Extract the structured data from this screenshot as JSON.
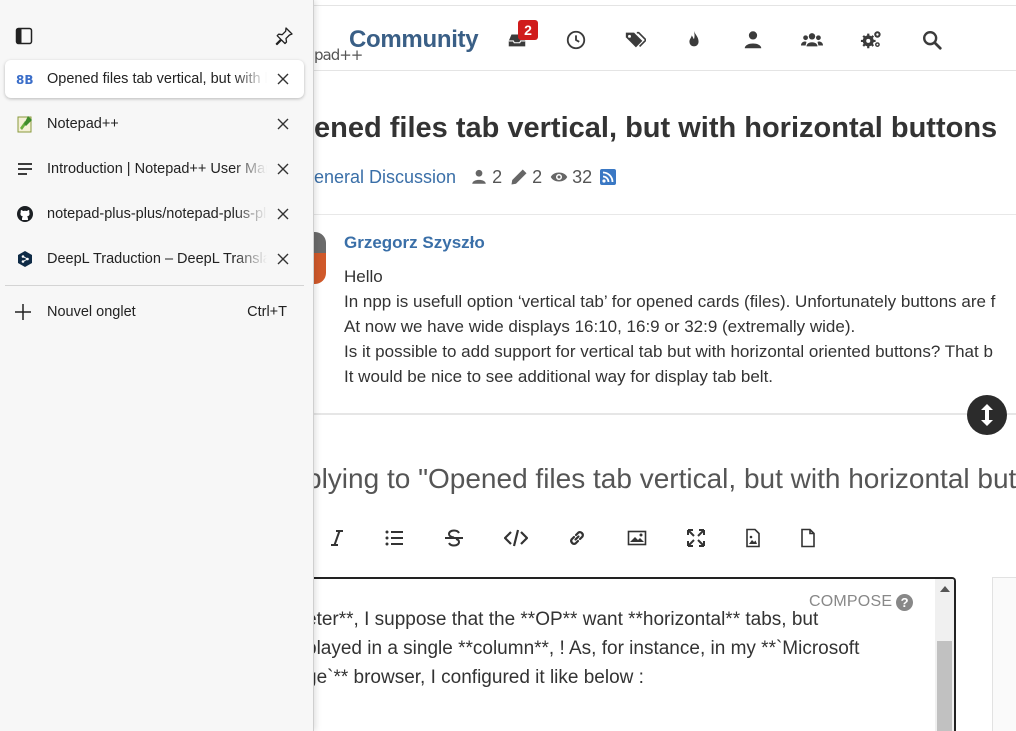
{
  "tabs_panel": {
    "tabs": [
      {
        "title": "Opened files tab vertical, but with horizontal buttons",
        "favicon": "nodebb-icon",
        "active": true
      },
      {
        "title": "Notepad++",
        "favicon": "notepad-plus-plus-icon",
        "active": false
      },
      {
        "title": "Introduction | Notepad++ User Manual",
        "favicon": "lines-icon",
        "active": false
      },
      {
        "title": "notepad-plus-plus/notepad-plus-plus",
        "favicon": "github-icon",
        "active": false
      },
      {
        "title": "DeepL Traduction – DeepL Translate",
        "favicon": "deepl-icon",
        "active": false
      }
    ],
    "new_tab": {
      "label": "Nouvel onglet",
      "shortcut": "Ctrl+T"
    }
  },
  "forum": {
    "logo_fragment": "pad++",
    "brand": "Community",
    "notifications_count": "2",
    "nav_icons": [
      "notifications-icon",
      "recent-icon",
      "tags-icon",
      "popular-icon",
      "user-icon",
      "groups-icon",
      "admin-icon",
      "search-icon"
    ],
    "topic": {
      "title": "ened files tab vertical, but with horizontal buttons",
      "category": "eneral Discussion",
      "posters": "2",
      "posts": "2",
      "views": "32"
    },
    "post": {
      "author": "Grzegorz Szyszło",
      "lines": [
        "Hello",
        "In npp is usefull option ‘vertical tab’ for opened cards (files). Unfortunately buttons are f",
        "At now we have wide displays 16:10, 16:9 or 32:9 (extremally wide).",
        "Is it possible to add support for vertical tab but with horizontal oriented buttons? That b",
        "It would be nice to see additional way for display tab belt."
      ]
    },
    "reply": {
      "title": "plying to \"Opened files tab vertical, but with horizontal but",
      "compose_label": "COMPOSE",
      "editor_lines": [
        "eter**, I suppose that the **OP** want **horizontal** tabs, but",
        "played in a single **column**, ! As, for instance, in my **`Microsoft",
        "ge`** browser, I configured it like below :"
      ]
    }
  }
}
